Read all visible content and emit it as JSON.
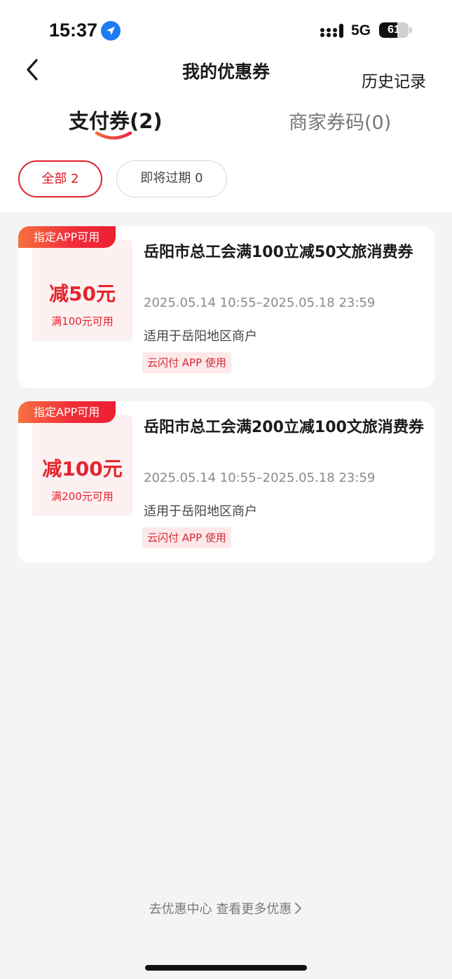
{
  "status_bar": {
    "time": "15:37",
    "network": "5G",
    "battery_level": "61",
    "battery_fraction": 0.61,
    "icons": [
      "location-arrow-icon",
      "cellular-signal-icon",
      "battery-icon"
    ]
  },
  "nav": {
    "title": "我的优惠券",
    "history_label": "历史记录",
    "back_icon": "chevron-left-icon"
  },
  "tabs": [
    {
      "label": "支付券(2)",
      "active": true
    },
    {
      "label": "商家券码(0)",
      "active": false
    }
  ],
  "filters": [
    {
      "label": "全部 2",
      "active": true
    },
    {
      "label": "即将过期 0",
      "active": false
    }
  ],
  "coupons": [
    {
      "tag": "指定APP可用",
      "amount": "减50元",
      "condition": "满100元可用",
      "title": "岳阳市总工会满100立减50文旅消费券",
      "validity": "2025.05.14 10:55–2025.05.18 23:59",
      "scope": "适用于岳阳地区商户",
      "platform": "云闪付 APP 使用"
    },
    {
      "tag": "指定APP可用",
      "amount": "减100元",
      "condition": "满200元可用",
      "title": "岳阳市总工会满200立减100文旅消费券",
      "validity": "2025.05.14 10:55–2025.05.18 23:59",
      "scope": "适用于岳阳地区商户",
      "platform": "云闪付 APP 使用"
    }
  ],
  "footer": {
    "link_text": "去优惠中心 查看更多优惠",
    "chevron_icon": "chevron-right-icon"
  },
  "colors": {
    "accent_red": "#e3242d",
    "tag_gradient_start": "#f6723f",
    "tag_gradient_end": "#ec2031",
    "page_background": "#f4f4f4",
    "location_blue": "#1e7cf2"
  }
}
